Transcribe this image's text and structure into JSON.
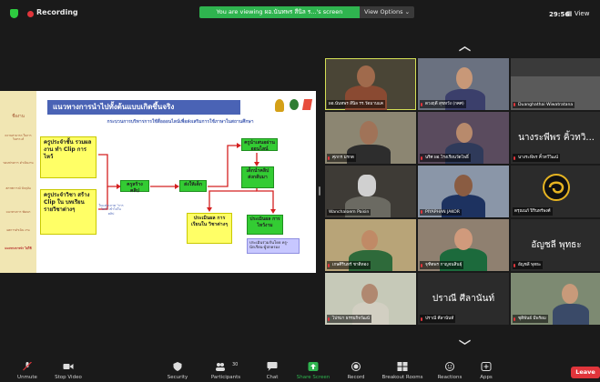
{
  "topbar": {
    "recording_label": "Recording",
    "viewing_banner": "You are viewing ผอ.นันทพร สีนิล ร...'s screen",
    "view_options_label": "View Options ⌄",
    "clock": "29:56",
    "view_label": "View"
  },
  "slide": {
    "title": "แนวทางการนำไปทั้งต้นแบบเกิดขึ้นจริง",
    "subtitle": "กระบวนการบริหารการใช้สื่อออนไลน์เพื่อส่งเสริมการใช้ภาษาในสถานศึกษา",
    "side_items": [
      "ชื่องาน",
      "ความสามารถ ในการวิเคราะห์",
      "ขอบข่ายการ ดำเนินงาน",
      "สภาพการณ์ ปัจจุบัน",
      "แนวทางการ พัฒนา",
      "ผลการดำเนิน งาน",
      "แนวทางการนำ ไปใช้"
    ],
    "box_teacher": "ครูประจำชั้น รวมผลงาน ทำ Clip การ ไหว้",
    "box_subject": "ครูประจำวิชา สร้าง Clip ใน บทเรียน รายวิชาต่างๆ",
    "box_create": "ครูสร้างคลิป",
    "box_send": "ส่งให้เด็ก",
    "box_online": "ครูนำเสนอผ่านออนไลน์",
    "box_track": "เด็กนำคลิป ส่งกลับมา",
    "box_eval_subject": "ประเมินผล การเรียนใน วิชาต่างๆ",
    "box_eval_wai": "ประเมินผล การไหว้งาม",
    "box_wai_eval_note": "ประเมินร่วมกันโดย ครู-นักเรียน-ผู้ปกครอง",
    "note_small": "ในแต่ละภาค \"การไหว้\" เข้าไปในคลิป"
  },
  "gallery": {
    "tiles": [
      {
        "name": "ผอ.นันทพร สีนิล รร.วัดมาบแค",
        "display": "",
        "muted": false,
        "active": true
      },
      {
        "name": "ดวงฤดี สุขหวัง (กคศ)",
        "display": "",
        "muted": true,
        "active": false
      },
      {
        "name": "Duanghathai Wiwatratana",
        "display": "",
        "muted": true,
        "active": false
      },
      {
        "name": "ศุภกร มรกต",
        "display": "",
        "muted": true,
        "active": false
      },
      {
        "name": "นริศ ผอ.โรงเรียนวัดโพธิ์",
        "display": "",
        "muted": true,
        "active": false
      },
      {
        "name": "นางระพีพร คิ้วทวีวิฒน์",
        "display": "นางระพีพร คิ้วทวิ...",
        "muted": true,
        "active": false
      },
      {
        "name": "Wanchaloem Paisin",
        "display": "",
        "muted": true,
        "active": false
      },
      {
        "name": "PIYAPHAN JAKOR",
        "display": "",
        "muted": true,
        "active": false
      },
      {
        "name": "ดรุณนภ์ ปิรินทร์พงศ์",
        "display": "",
        "muted": false,
        "active": false
      },
      {
        "name": "เกษศิรินทร์ ชาติทอง",
        "display": "",
        "muted": true,
        "active": false
      },
      {
        "name": "จุฑิตพร กาญจนสินธุ์",
        "display": "",
        "muted": true,
        "active": false
      },
      {
        "name": "อัญชลี พุทธะ",
        "display": "อัญชลี พุทธะ",
        "muted": true,
        "active": false
      },
      {
        "name": "ไปรมา ธรรมกิจวัฒน์",
        "display": "",
        "muted": true,
        "active": false
      },
      {
        "name": "ปราณี ศีลานันท์",
        "display": "ปราณี ศีลานันท์",
        "muted": true,
        "active": false
      },
      {
        "name": "ชุติพันธ์ มีพร้อม",
        "display": "",
        "muted": true,
        "active": false
      }
    ]
  },
  "toolbar": {
    "unmute": "Unmute",
    "stop_video": "Stop Video",
    "security": "Security",
    "participants": "Participants",
    "participants_count": "30",
    "chat": "Chat",
    "share_screen": "Share Screen",
    "record": "Record",
    "breakout": "Breakout Rooms",
    "reactions": "Reactions",
    "apps": "Apps",
    "leave": "Leave"
  },
  "colors": {
    "banner_green": "#2fb44f",
    "leave_red": "#e0353b",
    "active_speaker": "#d5e055",
    "slide_title_bg": "#4a63b5"
  }
}
